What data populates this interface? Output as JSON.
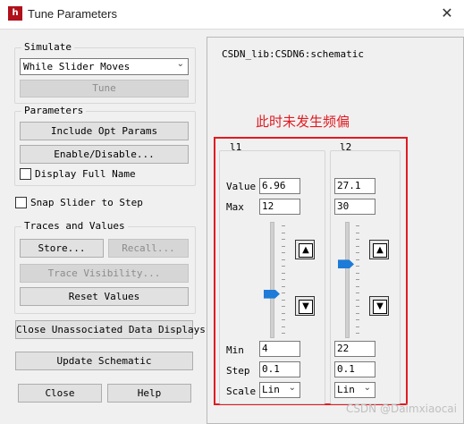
{
  "window": {
    "title": "Tune Parameters",
    "icon_text": "h"
  },
  "simulate": {
    "label": "Simulate",
    "mode": "While Slider Moves",
    "tune_button": "Tune"
  },
  "parameters": {
    "label": "Parameters",
    "include_opt": "Include Opt Params",
    "enable_disable": "Enable/Disable...",
    "display_full_name": "Display Full Name"
  },
  "snap_slider": "Snap Slider to Step",
  "traces": {
    "label": "Traces and Values",
    "store": "Store...",
    "recall": "Recall...",
    "trace_visibility": "Trace Visibility...",
    "reset_values": "Reset Values"
  },
  "close_unassociated": "Close Unassociated Data Displays",
  "update_schematic": "Update Schematic",
  "close_button": "Close",
  "help_button": "Help",
  "schematic_name": "CSDN_lib:CSDN6:schematic",
  "annotation": "此时未发生频偏",
  "params": [
    {
      "name": "l1",
      "value": "6.96",
      "max": "12",
      "min": "4",
      "step": "0.1",
      "scale": "Lin",
      "slider_level": 0.37
    },
    {
      "name": "l2",
      "value": "27.1",
      "max": "30",
      "min": "22",
      "step": "0.1",
      "scale": "Lin",
      "slider_level": 0.63
    }
  ],
  "labels": {
    "value": "Value",
    "max": "Max",
    "min": "Min",
    "step": "Step",
    "scale": "Scale"
  },
  "watermark": "CSDN @Daimxiaocai",
  "colors": {
    "accent": "#1e7bd7",
    "annotation": "#e11b22"
  }
}
